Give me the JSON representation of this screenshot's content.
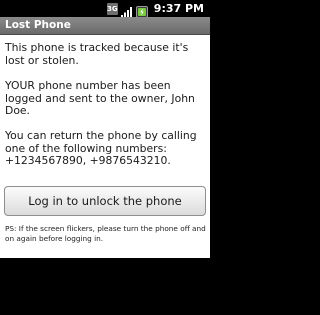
{
  "status_bar": {
    "network_label": "3G",
    "time": "9:37 PM",
    "icons": [
      "network-3g-icon",
      "signal-strength-icon",
      "battery-icon"
    ]
  },
  "window": {
    "title": "Lost Phone"
  },
  "message": {
    "paragraph_1": "This phone is tracked because it's lost or stolen.",
    "paragraph_2": "YOUR phone number has been logged and sent to the owner, John Doe.",
    "paragraph_3": "You can return the phone by calling one of the following numbers: +1234567890, +9876543210."
  },
  "actions": {
    "unlock_label": "Log in to unlock the phone"
  },
  "footer": {
    "ps_note": "PS: If the screen flickers, please turn the phone off and on again before logging in."
  },
  "colors": {
    "title_bar": "#7a7a7a",
    "background": "#ffffff",
    "status_bar": "#000000",
    "battery_accent": "#7ac943"
  }
}
